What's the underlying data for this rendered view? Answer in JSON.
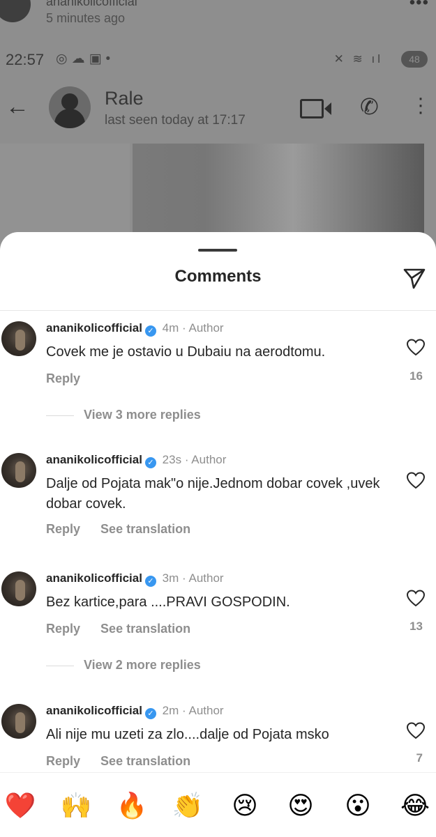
{
  "background": {
    "post_time": "5 minutes ago",
    "status_bar": {
      "time": "22:57",
      "battery": "48"
    },
    "chat": {
      "name": "Rale",
      "last_seen": "last seen today at 17:17"
    }
  },
  "sheet": {
    "title": "Comments"
  },
  "comments": [
    {
      "username": "ananikolicofficial",
      "time": "4m",
      "author_tag": "Author",
      "text": "Covek me je ostavio u Dubaiu na aerodtomu.",
      "reply_label": "Reply",
      "translation_label": "",
      "likes": "16",
      "more_replies": "View 3 more replies"
    },
    {
      "username": "ananikolicofficial",
      "time": "23s",
      "author_tag": "Author",
      "text": "Dalje od Pojata mak\"o nije.Jednom dobar covek ,uvek dobar covek.",
      "reply_label": "Reply",
      "translation_label": "See translation",
      "likes": "",
      "more_replies": ""
    },
    {
      "username": "ananikolicofficial",
      "time": "3m",
      "author_tag": "Author",
      "text": "Bez kartice,para ....PRAVI GOSPODIN.",
      "reply_label": "Reply",
      "translation_label": "See translation",
      "likes": "13",
      "more_replies": "View 2 more replies"
    },
    {
      "username": "ananikolicofficial",
      "time": "2m",
      "author_tag": "Author",
      "text": "Ali nije mu uzeti za zlo....dalje od Pojata msko",
      "reply_label": "Reply",
      "translation_label": "See translation",
      "likes": "7",
      "more_replies": ""
    }
  ],
  "emoji_bar": [
    "❤️",
    "🙌",
    "🔥",
    "👏",
    "😢",
    "😍",
    "😮",
    "😂"
  ],
  "colors": {
    "verified": "#3897f0",
    "secondary_text": "#8e8e8e",
    "primary_text": "#262626"
  }
}
